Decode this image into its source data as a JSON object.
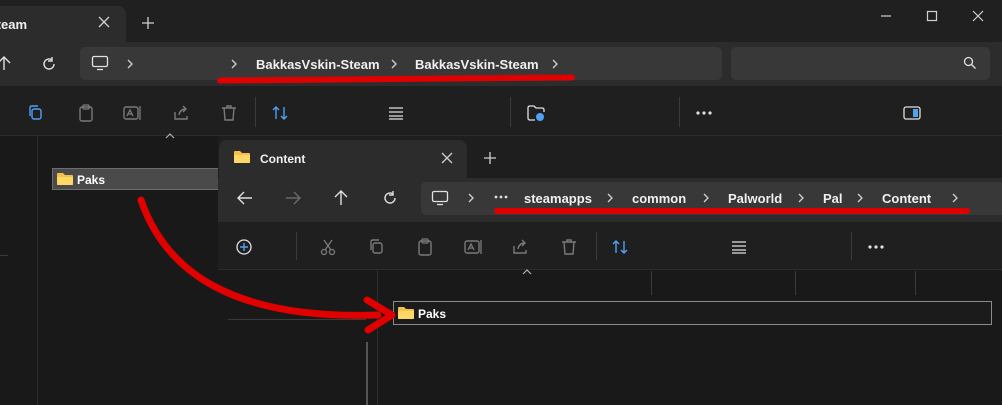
{
  "back_window": {
    "tab_title": "Steam",
    "breadcrumbs": [
      "BakkasVskin-Steam",
      "BakkasVskin-Steam"
    ],
    "file_item": "Paks"
  },
  "front_window": {
    "tab_title": "Content",
    "breadcrumbs": [
      "steamapps",
      "common",
      "Palworld",
      "Pal",
      "Content"
    ],
    "file_item": "Paks"
  },
  "icons": {
    "folder": "folder-icon",
    "close": "close-icon",
    "new_tab": "plus-icon",
    "back": "arrow-left-icon",
    "forward": "arrow-right-icon",
    "up": "arrow-up-icon",
    "refresh": "refresh-icon",
    "computer": "monitor-icon",
    "search": "search-icon"
  },
  "colors": {
    "annotation_red": "#e00000",
    "folder_yellow": "#f4c04a",
    "accent_blue": "#4ea1f3"
  }
}
